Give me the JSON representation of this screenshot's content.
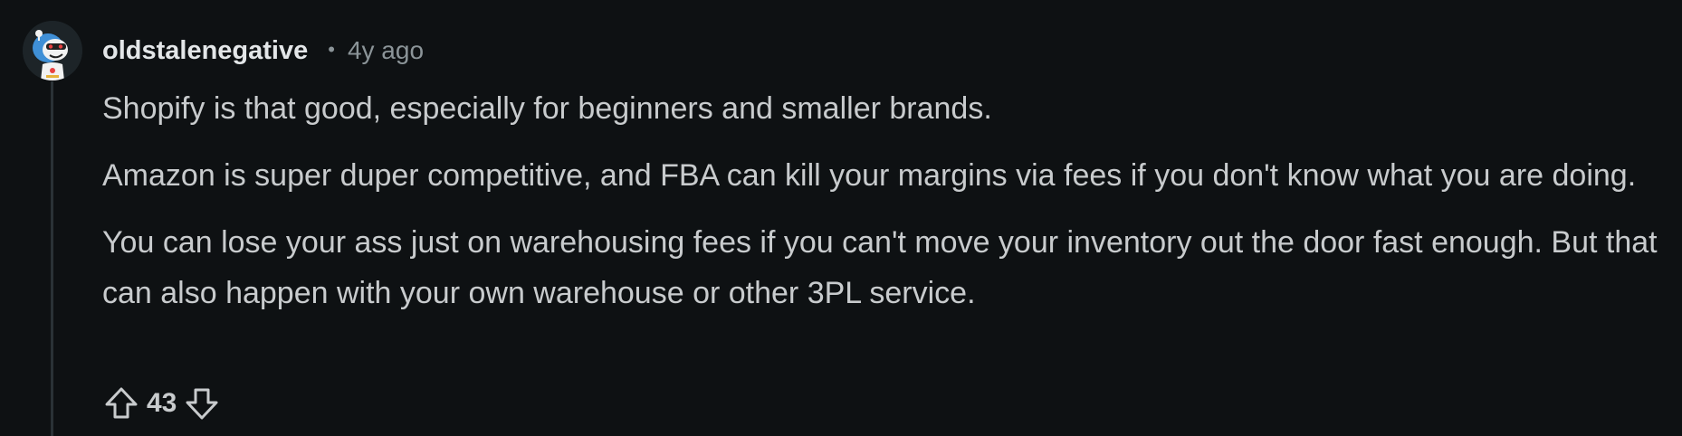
{
  "comment": {
    "author": "oldstalenegative",
    "separator": "•",
    "timestamp": "4y ago",
    "paragraphs": [
      "Shopify is that good, especially for beginners and smaller brands.",
      "Amazon is super duper competitive, and FBA can kill your margins via fees if you don't know what you are doing.",
      "You can lose your ass just on warehousing fees if you can't move your inventory out the door fast enough. But that can also happen with your own warehouse or other 3PL service."
    ],
    "score": "43"
  },
  "icons": {
    "avatar": "user-avatar",
    "upvote": "upvote-arrow-icon",
    "downvote": "downvote-arrow-icon"
  },
  "colors": {
    "background": "#0e1113",
    "text": "#c8cbcd",
    "username": "#e3e6e8",
    "meta": "#8b9498",
    "thread_line": "#2a3236"
  }
}
